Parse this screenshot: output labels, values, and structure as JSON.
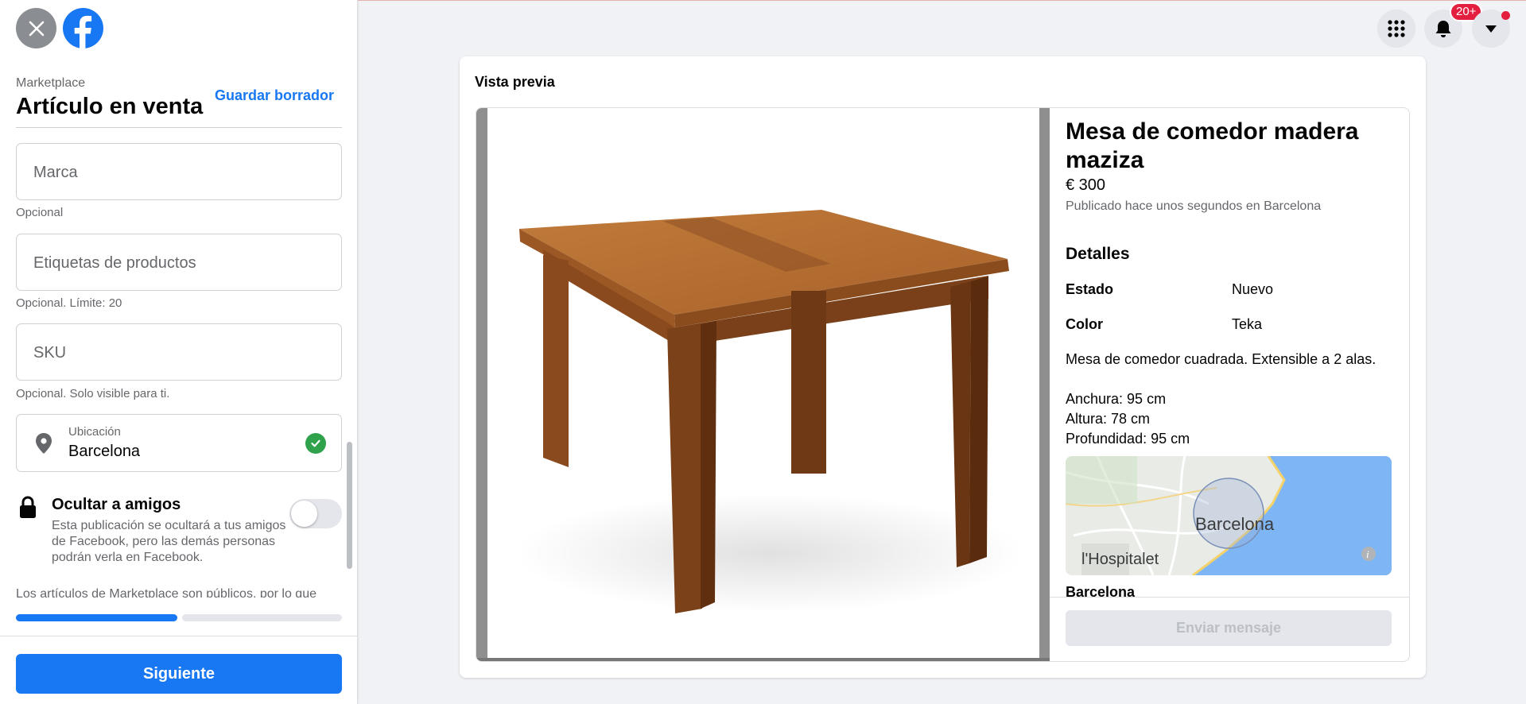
{
  "header": {
    "close_icon": "close-icon",
    "logo": "facebook-logo"
  },
  "sidebar": {
    "breadcrumb": "Marketplace",
    "title": "Artículo en venta",
    "save_draft": "Guardar borrador",
    "fields": {
      "brand": {
        "placeholder": "Marca",
        "hint": "Opcional"
      },
      "tags": {
        "placeholder": "Etiquetas de productos",
        "hint": "Opcional. Límite: 20"
      },
      "sku": {
        "placeholder": "SKU",
        "hint": "Opcional. Solo visible para ti."
      },
      "location": {
        "label": "Ubicación",
        "value": "Barcelona"
      }
    },
    "hide_from_friends": {
      "title": "Ocultar a amigos",
      "description": "Esta publicación se ocultará a tus amigos de Facebook, pero las demás personas podrán verla en Facebook.",
      "enabled": false
    },
    "notice": "Los artículos de Marketplace son públicos, por lo que",
    "progress": {
      "step": 1,
      "total_steps": 2
    },
    "next_button": "Siguiente"
  },
  "topbar": {
    "menu_icon": "grid-menu-icon",
    "notifications_icon": "bell-icon",
    "notifications_badge": "20+",
    "account_icon": "caret-down-icon"
  },
  "preview": {
    "label": "Vista previa",
    "listing": {
      "title": "Mesa de comedor madera maziza",
      "price": "€ 300",
      "meta": "Publicado hace unos segundos en Barcelona",
      "details_heading": "Detalles",
      "attributes": [
        {
          "key": "Estado",
          "value": "Nuevo"
        },
        {
          "key": "Color",
          "value": "Teka"
        }
      ],
      "description": "Mesa de comedor cuadrada. Extensible a 2 alas.",
      "dimensions": [
        "Anchura: 95 cm",
        "Altura: 78 cm",
        "Profundidad: 95 cm"
      ],
      "map_labels": {
        "city": "Barcelona",
        "nearby": "l'Hospitalet"
      },
      "location": "Barcelona",
      "send_button": "Enviar mensaje"
    }
  },
  "colors": {
    "primary": "#1877f2",
    "success": "#31a24c",
    "badge": "#e41e3f",
    "map_sea": "#7eb6f5"
  }
}
